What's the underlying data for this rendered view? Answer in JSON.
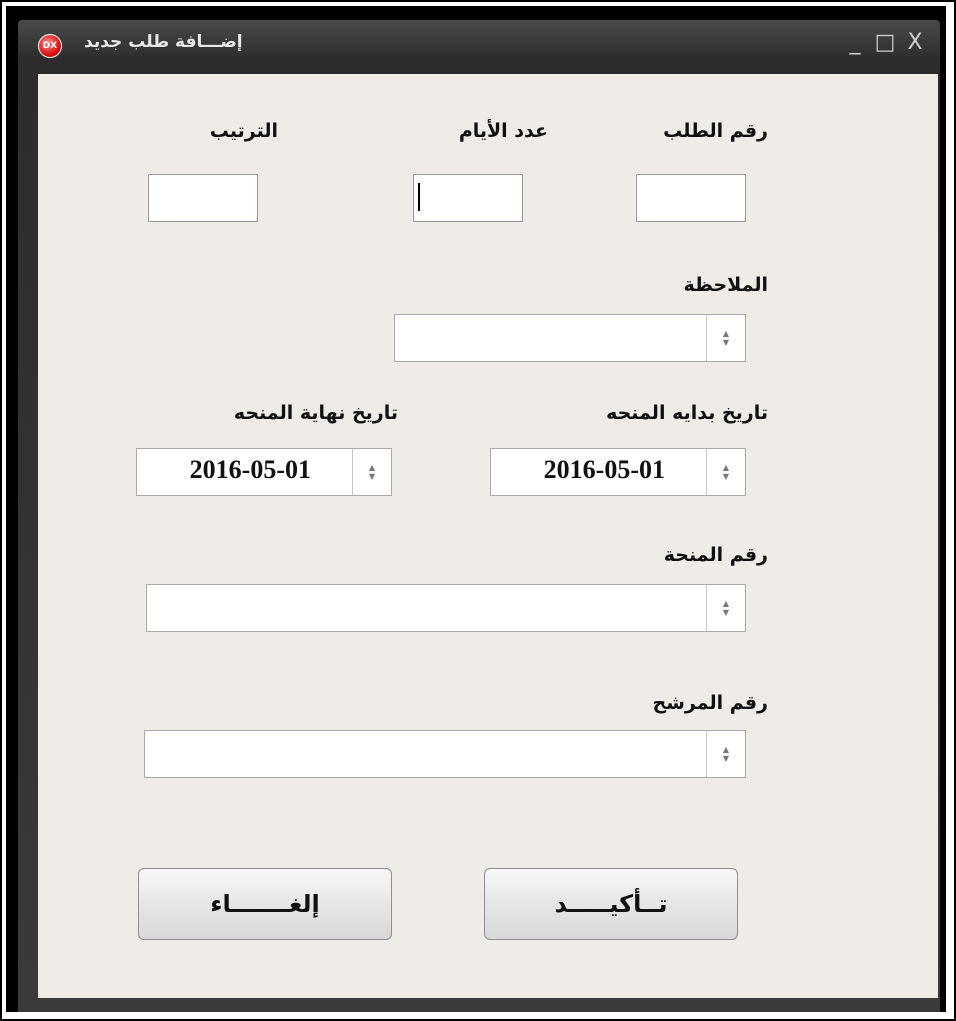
{
  "window": {
    "title": "إضـــافة طلب جديد",
    "logo_text": "DX",
    "controls": {
      "minimize": "_",
      "maximize": "□",
      "close": "X"
    }
  },
  "form": {
    "order_number": {
      "label": "رقم الطلب",
      "value": ""
    },
    "days_count": {
      "label": "عدد الأيام",
      "value": ""
    },
    "order_rank": {
      "label": "الترتيب",
      "value": ""
    },
    "note": {
      "label": "الملاحظة",
      "value": ""
    },
    "grant_start_date": {
      "label": "تاريخ بدايه المنحه",
      "value": "2016-05-01"
    },
    "grant_end_date": {
      "label": "تاريخ نهاية المنحه",
      "value": "2016-05-01"
    },
    "grant_number": {
      "label": "رقم المنحة",
      "value": ""
    },
    "candidate_number": {
      "label": "رقم المرشح",
      "value": ""
    }
  },
  "buttons": {
    "confirm": "تــأكيـــــد",
    "cancel": "إلغـــــــاء"
  },
  "icons": {
    "spin_up": "▲",
    "spin_down": "▼"
  }
}
